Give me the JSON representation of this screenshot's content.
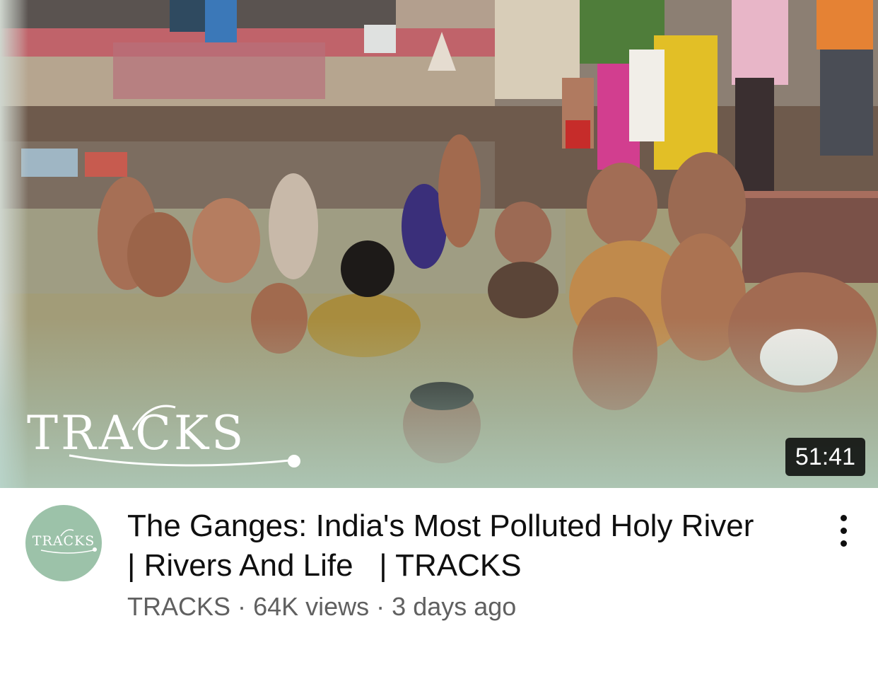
{
  "thumbnail": {
    "overlay_logo": "TRACKS",
    "duration": "51:41"
  },
  "channel": {
    "avatar_text": "TRACKS",
    "avatar_color": "#9cc2a9"
  },
  "video": {
    "title_line1": "The Ganges: India's Most Polluted Holy River",
    "title_line2": "| Rivers And Life   | TRACKS",
    "channel_name": "TRACKS",
    "separator": "·",
    "views": "64K views",
    "age": "3 days ago"
  },
  "icons": {
    "more": "more-vertical-icon"
  },
  "colors": {
    "title": "#0f0f0f",
    "secondary": "#606060",
    "duration_bg": "#000000"
  }
}
